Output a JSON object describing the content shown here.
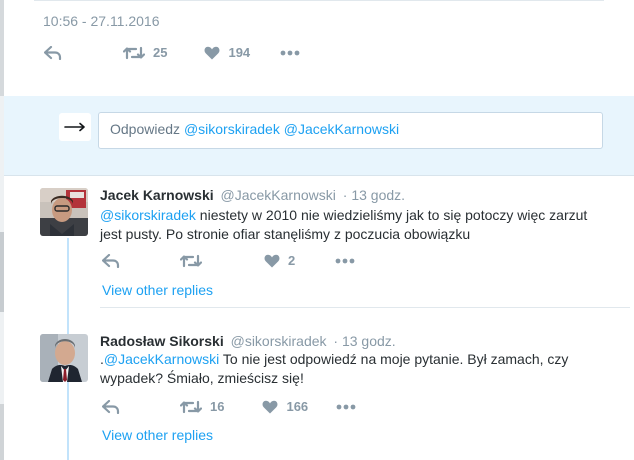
{
  "top_tweet": {
    "timestamp": "10:56 - 27.11.2016",
    "retweets": "25",
    "likes": "194"
  },
  "reply_box": {
    "prefix": "Odpowiedz",
    "mentions": "@sikorskiradek @JacekKarnowski"
  },
  "tweets": [
    {
      "name": "Jacek Karnowski",
      "handle": "@JacekKarnowski",
      "time": "· 13 godz.",
      "mention": "@sikorskiradek",
      "text_line1": " niestety w 2010 nie wiedzieliśmy jak to się potoczy więc zarzut",
      "text_line2": "jest pusty. Po stronie ofiar stanęliśmy z poczucia obowiązku",
      "retweets": "",
      "likes": "2",
      "more_link": "View other replies"
    },
    {
      "name": "Radosław Sikorski",
      "handle": "@sikorskiradek",
      "time": "· 13 godz.",
      "prefix": ".",
      "mention": "@JacekKarnowski",
      "text_line1": " To nie jest odpowiedź na moje pytanie.  Był zamach, czy",
      "text_line2": "wypadek?  Śmiało, zmieścisz się!",
      "retweets": "16",
      "likes": "166",
      "more_link": "View other replies"
    }
  ],
  "colors": {
    "accent": "#1da1f2",
    "muted": "#8899a6",
    "reply_bar_bg": "#e8f5fd",
    "thread_line": "#c2e3fb"
  }
}
